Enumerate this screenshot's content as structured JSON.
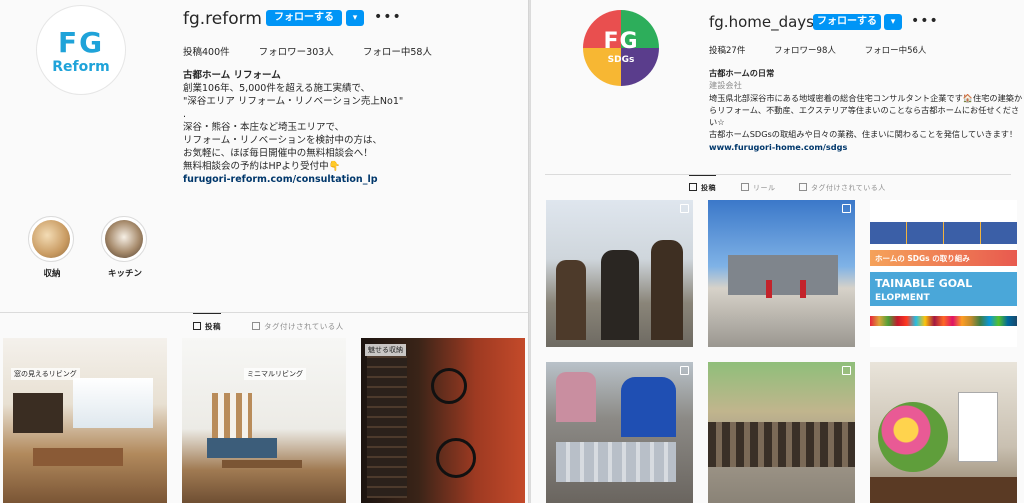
{
  "left": {
    "avatar": {
      "logo_top": "FG",
      "logo_bottom": "Reform",
      "color": "#1fa3d9"
    },
    "username": "fg.reform",
    "follow_label": "フォローする",
    "more_icon": "ellipsis-icon",
    "stats": {
      "posts": "投稿400件",
      "followers": "フォロワー303人",
      "following": "フォロー中58人"
    },
    "bio": {
      "name": "古都ホーム リフォーム",
      "lines": [
        "創業106年、5,000件を超える施工実績で、",
        "\"深谷エリア リフォーム・リノベーション売上No1\"",
        ".",
        "深谷・熊谷・本庄など埼玉エリアで、",
        "リフォーム・リノベーションを検討中の方は、",
        "お気軽に、ほぼ毎日開催中の無料相談会へ！",
        "無料相談会の予約はHPより受付中👇"
      ],
      "link": "furugori-reform.com/consultation_lp"
    },
    "highlights": [
      {
        "label": "収納"
      },
      {
        "label": "キッチン"
      }
    ],
    "tabs": {
      "posts": "投稿",
      "tagged": "タグ付けされている人"
    },
    "posts": [
      {
        "caption": "窓の見えるリビング"
      },
      {
        "caption": "ミニマルリビング"
      },
      {
        "caption": "魅せる収納"
      }
    ]
  },
  "right": {
    "avatar": {
      "logo_top": "FG",
      "logo_bottom": "SDGs"
    },
    "username": "fg.home_days",
    "follow_label": "フォローする",
    "more_icon": "ellipsis-icon",
    "stats": {
      "posts": "投稿27件",
      "followers": "フォロワー98人",
      "following": "フォロー中56人"
    },
    "bio": {
      "name": "古都ホームの日常",
      "category": "建設会社",
      "lines": [
        "埼玉県北部深谷市にある地域密着の総合住宅コンサルタント企業です🏠住宅の建築か",
        "らリフォーム、不動産、エクステリア等住まいのことなら古都ホームにお任せくださ",
        "い☆",
        "古都ホームSDGsの取組みや日々の業務、住まいに関わることを発信していきます！"
      ],
      "link": "www.furugori-home.com/sdgs"
    },
    "tabs": {
      "posts": "投稿",
      "reels": "リール",
      "tagged": "タグ付けされている人"
    },
    "posts": [
      {
        "caption": ""
      },
      {
        "caption": ""
      },
      {
        "caption": "ホームの SDGs の取り組み",
        "caption2": "TAINABLE GOAL",
        "caption3": "ELOPMENT"
      },
      {
        "caption": ""
      },
      {
        "caption": ""
      },
      {
        "caption": ""
      }
    ]
  }
}
